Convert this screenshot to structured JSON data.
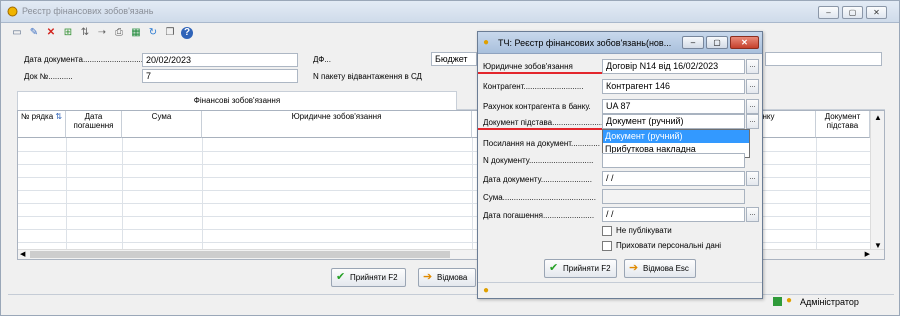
{
  "main": {
    "title": "Реєстр фінансових зобов'язань",
    "fields": {
      "doc_date_label": "Дата документа...........................",
      "doc_date": "20/02/2023",
      "doc_no_label": "Док №...........",
      "doc_no": "7",
      "df_label": "ДФ...",
      "df_value": "Бюджет",
      "pkg_label": "N пакету відвантаження в СД"
    },
    "tab": "Фінансові зобов'язання",
    "columns": [
      "№ рядка",
      "Дата погашення",
      "Сума",
      "Юридичне зобов'язання",
      "К",
      "анку",
      "Документ підстава"
    ],
    "accept_label": "Прийняти F2",
    "cancel_label": "Відмова",
    "status_user": "Адміністратор"
  },
  "dialog": {
    "title": "ТЧ: Реєстр фінансових зобов'язань(нов...",
    "fields": [
      {
        "label": "Юридичне зобов'язання",
        "value": "Договір N14 від 16/02/2023"
      },
      {
        "label": "Контрагент...........................",
        "value": "Контрагент 146"
      },
      {
        "label": "Рахунок контрагента в банку.",
        "value": "UA 87"
      },
      {
        "label": "Документ підстава.......................",
        "value": "Документ (ручний)"
      },
      {
        "label": "Посилання на документ.............",
        "value": ""
      },
      {
        "label": "N документу.............................",
        "value": ""
      },
      {
        "label": "Дата документу.......................",
        "value": " / /"
      },
      {
        "label": "Сума..........................................",
        "value": ""
      },
      {
        "label": "Дата погашення.......................",
        "value": " / /"
      }
    ],
    "dropdown_options": [
      "Документ (ручний)",
      "Прибуткова накладна"
    ],
    "check_publish": "Не публікувати",
    "check_hide": "Приховати персональні дані",
    "accept_label": "Прийняти F2",
    "cancel_label": "Відмова Esc"
  }
}
